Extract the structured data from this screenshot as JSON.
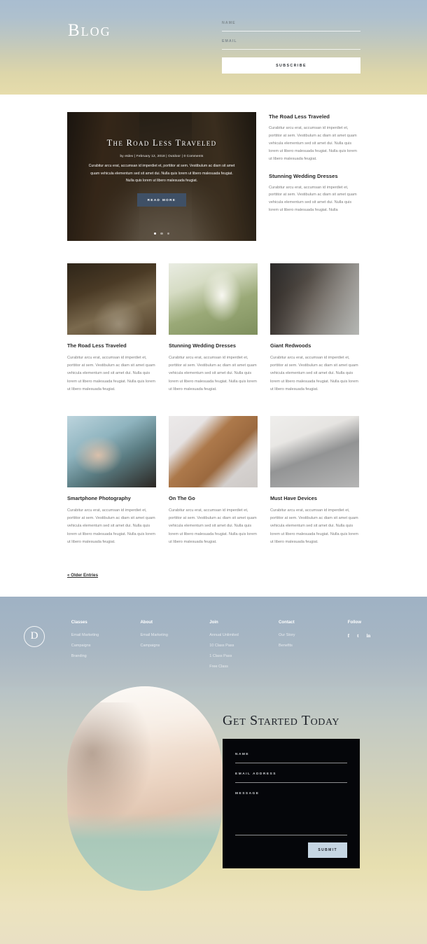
{
  "hero": {
    "title": "Blog",
    "form": {
      "name_label": "NAME",
      "name_value": "",
      "email_label": "EMAIL",
      "email_value": "",
      "subscribe_label": "SUBSCRIBE"
    }
  },
  "featured": {
    "slide": {
      "title": "The Road Less Traveled",
      "meta": "by etdev | February 12, 2018 | Outdoor | 0 Comments",
      "excerpt": "Curabitur arcu erat, accumsan id imperdiet et, porttitor at sem. Vestibulum ac diam sit amet quam vehicula elementum sed sit amet dui. Nulla quis lorem ut libero malesuada feugiat. Nulla quis lorem ut libero malesuada feugiat.",
      "button_label": "READ MORE",
      "dots": 3,
      "active_dot": 0,
      "button_color": "#3f5066"
    },
    "side_posts": [
      {
        "title": "The Road Less Traveled",
        "text": "Curabitur arcu erat, accumsan id imperdiet et, porttitor at sem. Vestibulum ac diam sit amet quam vehicula elementum sed sit amet dui. Nulla quis lorem ut libero malesuada feugiat. Nulla quis lorem ut libero malesuada feugiat."
      },
      {
        "title": "Stunning Wedding Dresses",
        "text": "Curabitur arcu erat, accumsan id imperdiet et, porttitor at sem. Vestibulum ac diam sit amet quam vehicula elementum sed sit amet dui. Nulla quis lorem ut libero malesuada feugiat. Nulla"
      }
    ]
  },
  "grid_rows": [
    [
      {
        "title": "The Road Less Traveled",
        "text": "Curabitur arcu erat, accumsan id imperdiet et, porttitor at sem. Vestibulum ac diam sit amet quam vehicula elementum sed sit amet dui. Nulla quis lorem ut libero malesuada feugiat. Nulla quis lorem ut libero malesuada feugiat.",
        "image": "forest-road-photo"
      },
      {
        "title": "Stunning Wedding Dresses",
        "text": "Curabitur arcu erat, accumsan id imperdiet et, porttitor at sem. Vestibulum ac diam sit amet quam vehicula elementum sed sit amet dui. Nulla quis lorem ut libero malesuada feugiat. Nulla quis lorem ut libero malesuada feugiat.",
        "image": "wedding-dress-photo"
      },
      {
        "title": "Giant Redwoods",
        "text": "Curabitur arcu erat, accumsan id imperdiet et, porttitor at sem. Vestibulum ac diam sit amet quam vehicula elementum sed sit amet dui. Nulla quis lorem ut libero malesuada feugiat. Nulla quis lorem ut libero malesuada feugiat.",
        "image": "redwood-trees-photo"
      }
    ],
    [
      {
        "title": "Smartphone Photography",
        "text": "Curabitur arcu erat, accumsan id imperdiet et, porttitor at sem. Vestibulum ac diam sit amet quam vehicula elementum sed sit amet dui. Nulla quis lorem ut libero malesuada feugiat. Nulla quis lorem ut libero malesuada feugiat.",
        "image": "hands-smartphone-photo"
      },
      {
        "title": "On The Go",
        "text": "Curabitur arcu erat, accumsan id imperdiet et, porttitor at sem. Vestibulum ac diam sit amet quam vehicula elementum sed sit amet dui. Nulla quis lorem ut libero malesuada feugiat. Nulla quis lorem ut libero malesuada feugiat.",
        "image": "phone-leather-case-photo"
      },
      {
        "title": "Must Have Devices",
        "text": "Curabitur arcu erat, accumsan id imperdiet et, porttitor at sem. Vestibulum ac diam sit amet quam vehicula elementum sed sit amet dui. Nulla quis lorem ut libero malesuada feugiat. Nulla quis lorem ut libero malesuada feugiat.",
        "image": "laptop-keyboard-photo"
      }
    ]
  ],
  "pagination": {
    "older_label": "« Older Entries"
  },
  "footer": {
    "logo_letter": "D",
    "columns": [
      {
        "heading": "Classes",
        "links": [
          "Email Marketing",
          "Campaigns",
          "Branding"
        ]
      },
      {
        "heading": "About",
        "links": [
          "Email Marketing",
          "Campaigns"
        ]
      },
      {
        "heading": "Join",
        "links": [
          "Annual Unlimited",
          "10 Class Pass",
          "1 Class Pass",
          "Free Class"
        ]
      },
      {
        "heading": "Contact",
        "links": [
          "Our Story",
          "Benefits"
        ]
      }
    ],
    "follow": {
      "heading": "Follow",
      "socials": [
        "facebook-icon",
        "twitter-icon",
        "linkedin-icon"
      ],
      "glyphs": [
        "f",
        "t",
        "in"
      ]
    }
  },
  "cta": {
    "title": "Get Started Today",
    "image": "woman-stretching-photo",
    "form": {
      "name_label": "NAME",
      "name_value": "",
      "email_label": "EMAIL ADDRESS",
      "email_value": "",
      "message_label": "MESSAGE",
      "message_value": "",
      "submit_label": "SUBMIT",
      "submit_color": "#c6d6e3"
    }
  }
}
